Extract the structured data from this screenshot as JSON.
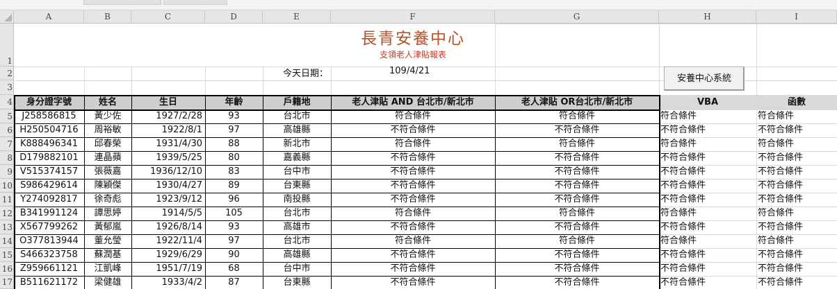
{
  "columns": [
    "A",
    "B",
    "C",
    "D",
    "E",
    "F",
    "G",
    "H",
    "I"
  ],
  "rows": [
    "1",
    "2",
    "3",
    "4",
    "5",
    "6",
    "7",
    "8",
    "9",
    "10",
    "11",
    "12",
    "13",
    "14",
    "15",
    "16",
    "17"
  ],
  "title": "長青安養中心",
  "subtitle": "支領老人津貼報表",
  "today_label": "今天日期：",
  "today_value": "109/4/21",
  "button_label": "安養中心系統",
  "headers": [
    "身分證字號",
    "姓名",
    "生日",
    "年齡",
    "戶籍地",
    "老人津貼 AND 台北市/新北市",
    "老人津貼 OR台北市/新北市",
    "VBA",
    "函數"
  ],
  "records": [
    [
      "J258586815",
      "黃少佐",
      "1927/2/28",
      "93",
      "台北市",
      "符合條件",
      "符合條件",
      "符合條件",
      "符合條件"
    ],
    [
      "H250504716",
      "周裕敏",
      "1922/8/1",
      "97",
      "高雄縣",
      "不符合條件",
      "不符合條件",
      "不符合條件",
      "不符合條件"
    ],
    [
      "K888496341",
      "邱春榮",
      "1931/4/30",
      "88",
      "新北市",
      "符合條件",
      "符合條件",
      "符合條件",
      "符合條件"
    ],
    [
      "D179882101",
      "連晶蘋",
      "1939/5/25",
      "80",
      "嘉義縣",
      "不符合條件",
      "不符合條件",
      "不符合條件",
      "不符合條件"
    ],
    [
      "V515374157",
      "張薇嘉",
      "1936/12/10",
      "83",
      "台中市",
      "不符合條件",
      "不符合條件",
      "不符合條件",
      "不符合條件"
    ],
    [
      "S986429614",
      "陳穎傑",
      "1930/4/27",
      "89",
      "台東縣",
      "不符合條件",
      "不符合條件",
      "不符合條件",
      "不符合條件"
    ],
    [
      "Y274092817",
      "徐奇彪",
      "1923/9/12",
      "96",
      "南投縣",
      "不符合條件",
      "不符合條件",
      "不符合條件",
      "不符合條件"
    ],
    [
      "B341991124",
      "譚思婷",
      "1914/5/5",
      "105",
      "台北市",
      "符合條件",
      "符合條件",
      "符合條件",
      "符合條件"
    ],
    [
      "X567799262",
      "黃郁嵐",
      "1926/8/14",
      "93",
      "高雄市",
      "不符合條件",
      "不符合條件",
      "不符合條件",
      "不符合條件"
    ],
    [
      "O377813944",
      "董允瑩",
      "1922/11/4",
      "97",
      "台北市",
      "符合條件",
      "符合條件",
      "符合條件",
      "符合條件"
    ],
    [
      "S466323758",
      "蘇潤基",
      "1929/6/29",
      "90",
      "高雄縣",
      "不符合條件",
      "不符合條件",
      "不符合條件",
      "不符合條件"
    ],
    [
      "Z959661121",
      "江凱峰",
      "1951/7/19",
      "68",
      "台中市",
      "不符合條件",
      "不符合條件",
      "不符合條件",
      "不符合條件"
    ],
    [
      "B511621172",
      "梁健雄",
      "1933/4/2",
      "87",
      "台東縣",
      "不符合條件",
      "不符合條件",
      "不符合條件",
      "不符合條件"
    ]
  ]
}
